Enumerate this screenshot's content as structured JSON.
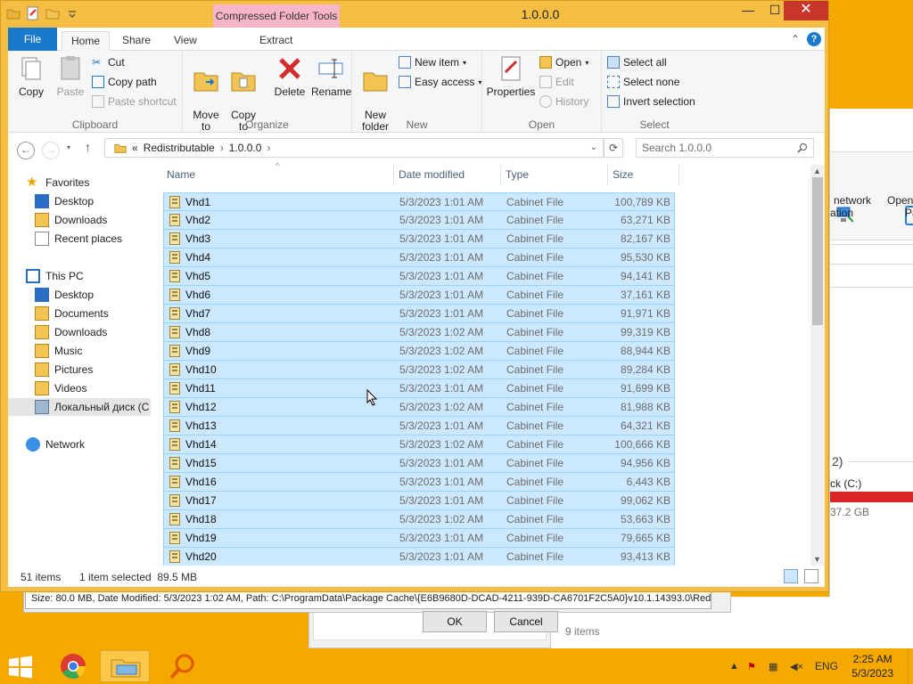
{
  "window": {
    "title": "1.0.0.0",
    "context_tab": "Compressed Folder Tools",
    "controls": {
      "minimize": "—",
      "maximize": "☐",
      "close": "✕"
    }
  },
  "tabs": [
    "File",
    "Home",
    "Share",
    "View",
    "Extract"
  ],
  "ribbon": {
    "clipboard": {
      "label": "Clipboard",
      "copy": "Copy",
      "paste": "Paste",
      "cut": "Cut",
      "copy_path": "Copy path",
      "paste_shortcut": "Paste shortcut"
    },
    "organize": {
      "label": "Organize",
      "move_to": "Move\nto",
      "copy_to": "Copy\nto",
      "delete": "Delete",
      "rename": "Rename"
    },
    "new": {
      "label": "New",
      "new_folder": "New\nfolder",
      "new_item": "New item",
      "easy_access": "Easy access"
    },
    "open": {
      "label": "Open",
      "properties": "Properties",
      "open": "Open",
      "edit": "Edit",
      "history": "History"
    },
    "select": {
      "label": "Select",
      "select_all": "Select all",
      "select_none": "Select none",
      "invert_selection": "Invert selection"
    }
  },
  "address": {
    "breadcrumb_prefix": "«",
    "segments": [
      "Redistributable",
      "1.0.0.0"
    ],
    "search_placeholder": "Search 1.0.0.0"
  },
  "nav": {
    "favorites": "Favorites",
    "favorites_items": [
      "Desktop",
      "Downloads",
      "Recent places"
    ],
    "this_pc": "This PC",
    "this_pc_items": [
      "Desktop",
      "Documents",
      "Downloads",
      "Music",
      "Pictures",
      "Videos",
      "Локальный диск (C"
    ],
    "network": "Network"
  },
  "columns": {
    "name": "Name",
    "date": "Date modified",
    "type": "Type",
    "size": "Size"
  },
  "files": [
    {
      "name": "Vhd1",
      "date": "5/3/2023 1:01 AM",
      "type": "Cabinet File",
      "size": "100,789 KB"
    },
    {
      "name": "Vhd2",
      "date": "5/3/2023 1:01 AM",
      "type": "Cabinet File",
      "size": "63,271 KB"
    },
    {
      "name": "Vhd3",
      "date": "5/3/2023 1:01 AM",
      "type": "Cabinet File",
      "size": "82,167 KB"
    },
    {
      "name": "Vhd4",
      "date": "5/3/2023 1:01 AM",
      "type": "Cabinet File",
      "size": "95,530 KB"
    },
    {
      "name": "Vhd5",
      "date": "5/3/2023 1:01 AM",
      "type": "Cabinet File",
      "size": "94,141 KB"
    },
    {
      "name": "Vhd6",
      "date": "5/3/2023 1:01 AM",
      "type": "Cabinet File",
      "size": "37,161 KB"
    },
    {
      "name": "Vhd7",
      "date": "5/3/2023 1:01 AM",
      "type": "Cabinet File",
      "size": "91,971 KB"
    },
    {
      "name": "Vhd8",
      "date": "5/3/2023 1:02 AM",
      "type": "Cabinet File",
      "size": "99,319 KB"
    },
    {
      "name": "Vhd9",
      "date": "5/3/2023 1:02 AM",
      "type": "Cabinet File",
      "size": "88,944 KB"
    },
    {
      "name": "Vhd10",
      "date": "5/3/2023 1:02 AM",
      "type": "Cabinet File",
      "size": "89,284 KB"
    },
    {
      "name": "Vhd11",
      "date": "5/3/2023 1:01 AM",
      "type": "Cabinet File",
      "size": "91,699 KB"
    },
    {
      "name": "Vhd12",
      "date": "5/3/2023 1:02 AM",
      "type": "Cabinet File",
      "size": "81,988 KB"
    },
    {
      "name": "Vhd13",
      "date": "5/3/2023 1:01 AM",
      "type": "Cabinet File",
      "size": "64,321 KB"
    },
    {
      "name": "Vhd14",
      "date": "5/3/2023 1:02 AM",
      "type": "Cabinet File",
      "size": "100,666 KB"
    },
    {
      "name": "Vhd15",
      "date": "5/3/2023 1:01 AM",
      "type": "Cabinet File",
      "size": "94,956 KB"
    },
    {
      "name": "Vhd16",
      "date": "5/3/2023 1:01 AM",
      "type": "Cabinet File",
      "size": "6,443 KB"
    },
    {
      "name": "Vhd17",
      "date": "5/3/2023 1:01 AM",
      "type": "Cabinet File",
      "size": "99,062 KB"
    },
    {
      "name": "Vhd18",
      "date": "5/3/2023 1:02 AM",
      "type": "Cabinet File",
      "size": "53,663 KB"
    },
    {
      "name": "Vhd19",
      "date": "5/3/2023 1:01 AM",
      "type": "Cabinet File",
      "size": "79,665 KB"
    },
    {
      "name": "Vhd20",
      "date": "5/3/2023 1:01 AM",
      "type": "Cabinet File",
      "size": "93,413 KB"
    }
  ],
  "status": {
    "item_count": "51 items",
    "selection": "1 item selected  89.5 MB"
  },
  "background": {
    "network_label_1": "network",
    "network_label_2": "ation",
    "open_label_1": "Open",
    "open_label_2": "Pa",
    "section_count": "2)",
    "drive_label": "ck (C:)",
    "drive_free": "37.2 GB",
    "items_label": "9 items",
    "properties_path": "Size: 80.0 MB, Date Modified: 5/3/2023 1:02 AM, Path: C:\\ProgramData\\Package Cache\\{E6B9680D-DCAD-4211-939D-CA6701F2C5A0}v10.1.14393.0\\Redist",
    "ok": "OK",
    "cancel": "Cancel"
  },
  "taskbar": {
    "tray_lang": "ENG",
    "time": "2:25 AM",
    "date": "5/3/2023"
  },
  "colors": {
    "accent": "#1979ca",
    "selection": "#cce8ff",
    "selection_border": "#99d1ff",
    "window_frame": "#f4bd43",
    "close_button": "#c8362b",
    "context_tab": "#f7b5c8"
  }
}
